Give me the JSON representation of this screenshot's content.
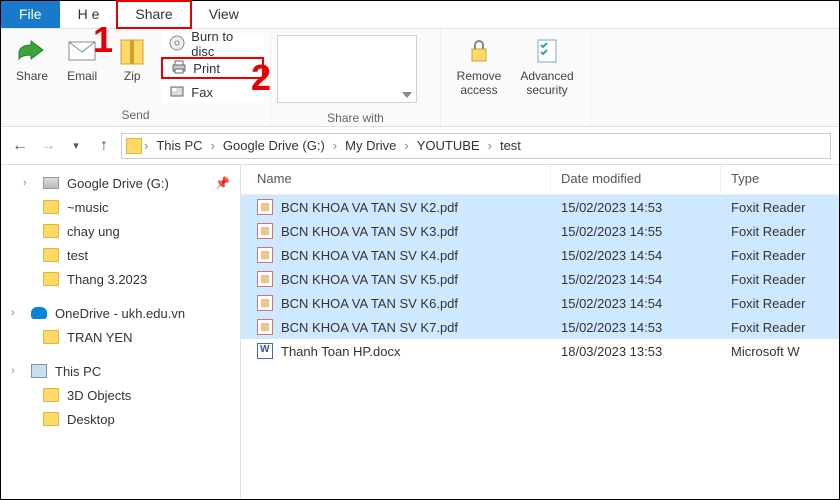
{
  "menubar": {
    "file": "File",
    "home": "H       e",
    "share": "Share",
    "view": "View"
  },
  "ribbon": {
    "send": {
      "share": "Share",
      "email": "Email",
      "zip": "Zip",
      "burn": "Burn to disc",
      "print": "Print",
      "fax": "Fax",
      "label": "Send"
    },
    "sharewith": {
      "label": "Share with"
    },
    "security": {
      "remove": "Remove\naccess",
      "advanced": "Advanced\nsecurity"
    }
  },
  "annotations": {
    "one": "1",
    "two": "2"
  },
  "breadcrumb": {
    "items": [
      "This PC",
      "Google Drive (G:)",
      "My Drive",
      "YOUTUBE",
      "test"
    ]
  },
  "sidebar": {
    "groups": [
      {
        "kind": "drive",
        "label": "Google Drive (G:)",
        "pinned": true
      },
      {
        "kind": "folder",
        "label": "~music"
      },
      {
        "kind": "folder",
        "label": "chay ung"
      },
      {
        "kind": "folder",
        "label": "test"
      },
      {
        "kind": "folder",
        "label": "Thang 3.2023"
      },
      {
        "kind": "onedrive",
        "label": "OneDrive - ukh.edu.vn",
        "root": true
      },
      {
        "kind": "folder",
        "label": "TRAN YEN"
      },
      {
        "kind": "thispc",
        "label": "This PC",
        "root": true
      },
      {
        "kind": "folder3d",
        "label": "3D Objects"
      },
      {
        "kind": "desktop",
        "label": "Desktop"
      }
    ]
  },
  "columns": {
    "name": "Name",
    "date": "Date modified",
    "type": "Type"
  },
  "files": [
    {
      "name": "BCN KHOA VA TAN SV K2.pdf",
      "date": "15/02/2023 14:53",
      "type": "Foxit Reader",
      "selected": true,
      "icon": "pdf"
    },
    {
      "name": "BCN KHOA VA TAN SV K3.pdf",
      "date": "15/02/2023 14:55",
      "type": "Foxit Reader",
      "selected": true,
      "icon": "pdf"
    },
    {
      "name": "BCN KHOA VA TAN SV K4.pdf",
      "date": "15/02/2023 14:54",
      "type": "Foxit Reader",
      "selected": true,
      "icon": "pdf"
    },
    {
      "name": "BCN KHOA VA TAN SV K5.pdf",
      "date": "15/02/2023 14:54",
      "type": "Foxit Reader",
      "selected": true,
      "icon": "pdf"
    },
    {
      "name": "BCN KHOA VA TAN SV K6.pdf",
      "date": "15/02/2023 14:54",
      "type": "Foxit Reader",
      "selected": true,
      "icon": "pdf"
    },
    {
      "name": "BCN KHOA VA TAN SV K7.pdf",
      "date": "15/02/2023 14:53",
      "type": "Foxit Reader",
      "selected": true,
      "icon": "pdf"
    },
    {
      "name": "Thanh Toan HP.docx",
      "date": "18/03/2023 13:53",
      "type": "Microsoft W",
      "selected": false,
      "icon": "doc"
    }
  ]
}
